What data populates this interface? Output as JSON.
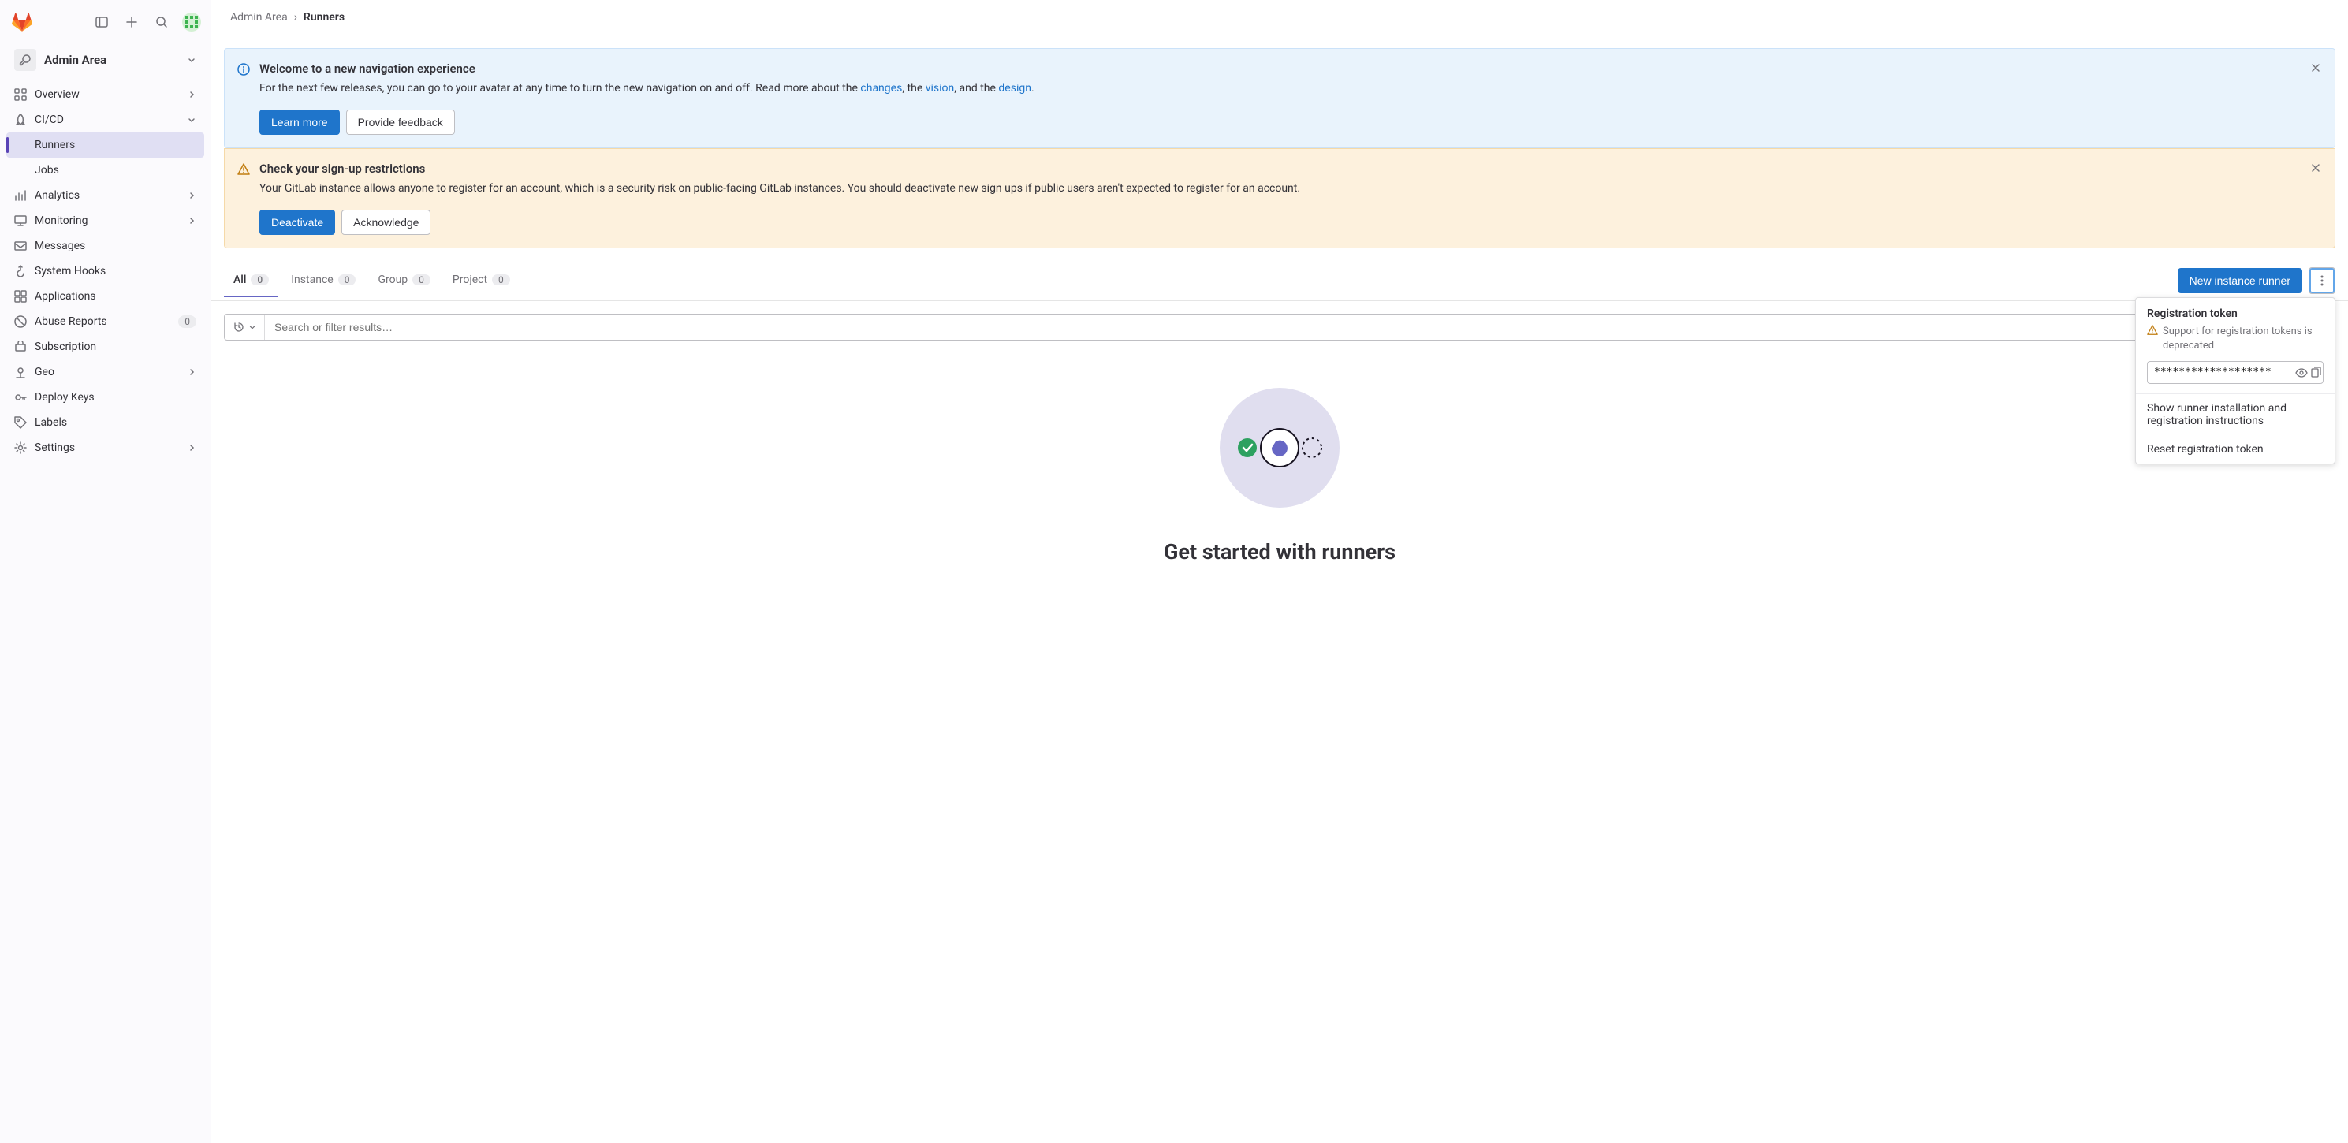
{
  "sidebar": {
    "context_title": "Admin Area",
    "items": [
      {
        "label": "Overview",
        "icon": "overview",
        "expandable": true
      },
      {
        "label": "CI/CD",
        "icon": "rocket",
        "expandable": true,
        "expanded": true,
        "children": [
          {
            "label": "Runners",
            "active": true
          },
          {
            "label": "Jobs",
            "active": false
          }
        ]
      },
      {
        "label": "Analytics",
        "icon": "chart",
        "expandable": true
      },
      {
        "label": "Monitoring",
        "icon": "monitor",
        "expandable": true
      },
      {
        "label": "Messages",
        "icon": "messages"
      },
      {
        "label": "System Hooks",
        "icon": "hook"
      },
      {
        "label": "Applications",
        "icon": "apps"
      },
      {
        "label": "Abuse Reports",
        "icon": "abuse",
        "badge": "0"
      },
      {
        "label": "Subscription",
        "icon": "token"
      },
      {
        "label": "Geo",
        "icon": "geo",
        "expandable": true
      },
      {
        "label": "Deploy Keys",
        "icon": "key"
      },
      {
        "label": "Labels",
        "icon": "label"
      },
      {
        "label": "Settings",
        "icon": "gear",
        "expandable": true
      }
    ]
  },
  "breadcrumbs": [
    "Admin Area",
    "Runners"
  ],
  "alert_info": {
    "title": "Welcome to a new navigation experience",
    "text_pre": "For the next few releases, you can go to your avatar at any time to turn the new navigation on and off. Read more about the ",
    "link1": "changes",
    "mid1": ", the ",
    "link2": "vision",
    "mid2": ", and the ",
    "link3": "design",
    "tail": ".",
    "learn_more": "Learn more",
    "feedback": "Provide feedback"
  },
  "alert_warn": {
    "title": "Check your sign-up restrictions",
    "text": "Your GitLab instance allows anyone to register for an account, which is a security risk on public-facing GitLab instances. You should deactivate new sign ups if public users aren't expected to register for an account.",
    "deactivate": "Deactivate",
    "acknowledge": "Acknowledge"
  },
  "tabs": [
    {
      "label": "All",
      "count": "0",
      "active": true
    },
    {
      "label": "Instance",
      "count": "0"
    },
    {
      "label": "Group",
      "count": "0"
    },
    {
      "label": "Project",
      "count": "0"
    }
  ],
  "new_runner_btn": "New instance runner",
  "search": {
    "placeholder": "Search or filter results…"
  },
  "empty": {
    "title": "Get started with runners"
  },
  "popover": {
    "title": "Registration token",
    "warn": "Support for registration tokens is deprecated",
    "token_value": "*******************",
    "link_install": "Show runner installation and registration instructions",
    "link_reset": "Reset registration token"
  }
}
